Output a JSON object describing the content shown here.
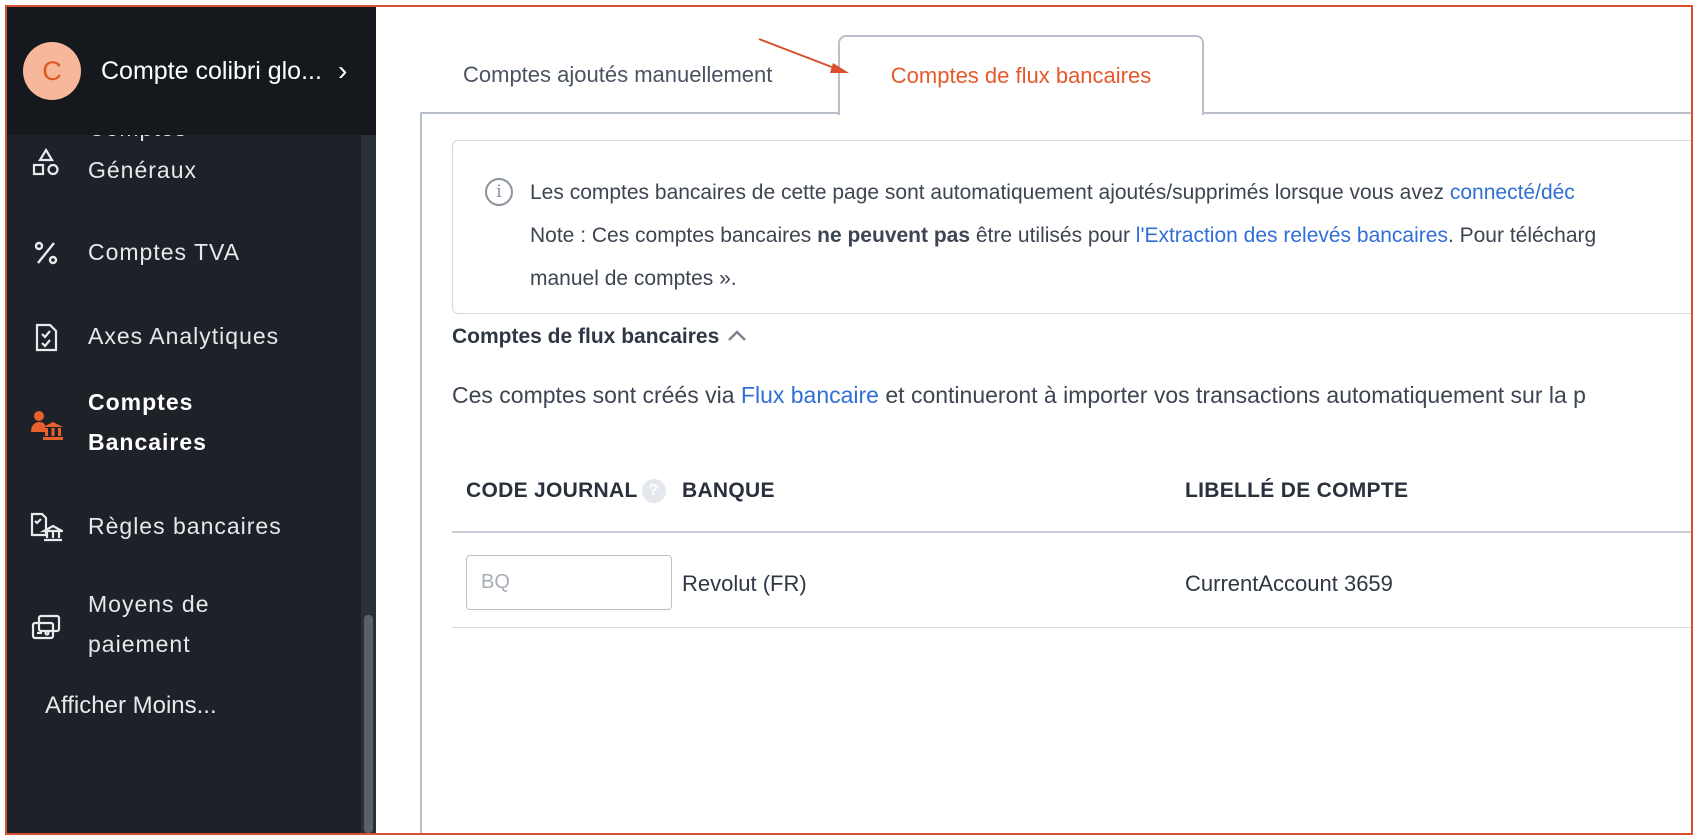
{
  "account": {
    "initial": "C",
    "name": "Compte colibri glo...",
    "chevron": "›"
  },
  "sidebar": {
    "items": [
      {
        "label": "Comptes\nGénéraux",
        "line1": "Comptes",
        "line2": "Généraux",
        "icon": "shapes-icon"
      },
      {
        "label": "Comptes TVA",
        "icon": "percent-icon"
      },
      {
        "label": "Axes Analytiques",
        "icon": "clipboard-check-icon"
      },
      {
        "label": "Comptes Bancaires",
        "line1": "Comptes",
        "line2": "Bancaires",
        "icon": "bank-users-icon",
        "active": true
      },
      {
        "label": "Règles bancaires",
        "icon": "bank-rules-icon"
      },
      {
        "label": "Moyens de paiement",
        "line1": "Moyens de",
        "line2": "paiement",
        "icon": "payment-methods-icon"
      }
    ],
    "show_less": "Afficher Moins..."
  },
  "tabs": {
    "manual": "Comptes ajoutés manuellement",
    "feeds": "Comptes de flux bancaires"
  },
  "info": {
    "icon": "i",
    "line1_prefix": "Les comptes bancaires de cette page sont automatiquement ajoutés/supprimés lorsque vous avez ",
    "line1_link": "connecté/déc",
    "line2_prefix": "Note : Ces comptes bancaires ",
    "line2_bold": "ne peuvent pas",
    "line2_mid": " être utilisés pour ",
    "line2_link": "l'Extraction des relevés bancaires",
    "line2_suffix": ". Pour télécharg",
    "line3": "manuel de comptes »."
  },
  "section": {
    "title": "Comptes de flux bancaires",
    "desc_prefix": "Ces comptes sont créés via ",
    "desc_link": "Flux bancaire",
    "desc_suffix": " et continueront à importer vos transactions automatiquement sur la p"
  },
  "table": {
    "headers": {
      "journal": "CODE JOURNAL",
      "help": "?",
      "bank": "BANQUE",
      "label": "LIBELLÉ DE COMPTE"
    },
    "rows": [
      {
        "journal_placeholder": "BQ",
        "bank": "Revolut (FR)",
        "label": "CurrentAccount 3659"
      }
    ]
  },
  "colors": {
    "accent": "#e5592c",
    "sidebar_bg": "#1e2228",
    "link": "#2f6fd6"
  }
}
